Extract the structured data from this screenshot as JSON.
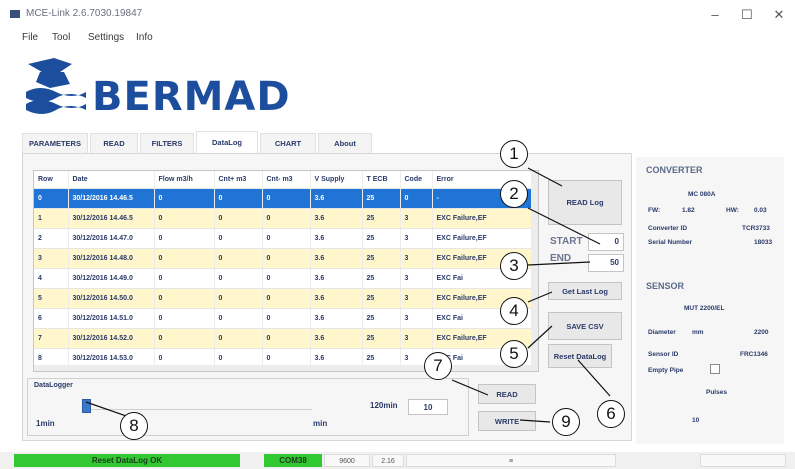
{
  "window": {
    "title": "MCE-Link 2.6.7030.19847",
    "controls": [
      "–",
      "☐",
      "✕"
    ]
  },
  "menu": [
    "File",
    "Tool",
    "Settings",
    "Info"
  ],
  "logo_text": "BERMAD",
  "tabs": [
    "PARAMETERS",
    "READ",
    "FILTERS",
    "DataLog",
    "CHART",
    "About"
  ],
  "active_tab": "DataLog",
  "table": {
    "columns": [
      "Row",
      "Date",
      "Flow m3/h",
      "Cnt+ m3",
      "Cnt- m3",
      "V Supply",
      "T ECB",
      "Code",
      "Error"
    ],
    "rows": [
      [
        "0",
        "30/12/2016 14.46.5",
        "0",
        "0",
        "0",
        "3.6",
        "25",
        "0",
        "-"
      ],
      [
        "1",
        "30/12/2016 14.46.5",
        "0",
        "0",
        "0",
        "3.6",
        "25",
        "3",
        "EXC Failure,EF"
      ],
      [
        "2",
        "30/12/2016 14.47.0",
        "0",
        "0",
        "0",
        "3.6",
        "25",
        "3",
        "EXC Failure,EF"
      ],
      [
        "3",
        "30/12/2016 14.48.0",
        "0",
        "0",
        "0",
        "3.6",
        "25",
        "3",
        "EXC Failure,EF"
      ],
      [
        "4",
        "30/12/2016 14.49.0",
        "0",
        "0",
        "0",
        "3.6",
        "25",
        "3",
        "EXC Fai"
      ],
      [
        "5",
        "30/12/2016 14.50.0",
        "0",
        "0",
        "0",
        "3.6",
        "25",
        "3",
        "EXC Failure,EF"
      ],
      [
        "6",
        "30/12/2016 14.51.0",
        "0",
        "0",
        "0",
        "3.6",
        "25",
        "3",
        "EXC Fai"
      ],
      [
        "7",
        "30/12/2016 14.52.0",
        "0",
        "0",
        "0",
        "3.6",
        "25",
        "3",
        "EXC Failure,EF"
      ],
      [
        "8",
        "30/12/2016 14.53.0",
        "0",
        "0",
        "0",
        "3.6",
        "25",
        "3",
        "EXC Fai"
      ]
    ]
  },
  "buttons": {
    "read_log": "READ Log",
    "get_last_log": "Get Last Log",
    "save_csv": "SAVE CSV",
    "reset_datalog": "Reset DataLog",
    "read": "READ",
    "write": "WRITE"
  },
  "range": {
    "start_label": "START",
    "start_value": "0",
    "end_label": "END",
    "end_value": "50"
  },
  "datalogger": {
    "title": "DataLogger",
    "min_label": "1min",
    "unit_label": "min",
    "max_label": "120min",
    "value": "10",
    "slider_fraction": 0.0
  },
  "converter": {
    "heading": "CONVERTER",
    "model": "MC 080A",
    "fw_label": "FW:",
    "fw_value": "1.82",
    "hw_label": "HW:",
    "hw_value": "0.03",
    "converter_id_label": "Converter ID",
    "converter_id_value": "TCR3733",
    "serial_label": "Serial Number",
    "serial_value": "18033"
  },
  "sensor": {
    "heading": "SENSOR",
    "model": "MUT 2200/EL",
    "diameter_label": "Diameter",
    "diameter_unit": "mm",
    "diameter_value": "2200",
    "sensor_id_label": "Sensor ID",
    "sensor_id_value": "FRC1346",
    "empty_pipe_label": "Empty Pipe",
    "pulses_label": "Pulses",
    "pulses_value": "10"
  },
  "callouts": [
    "1",
    "2",
    "3",
    "4",
    "5",
    "6",
    "7",
    "8",
    "9"
  ],
  "status": {
    "message": "Reset DataLog OK",
    "port": "COM38",
    "baud": "9600",
    "version": "2.16",
    "indicator": "≡"
  },
  "colors": {
    "selected_row": "#1f74d6",
    "alt_row": "#fff6cc",
    "status_ok": "#32c832",
    "brand_blue": "#1d4e9e"
  }
}
